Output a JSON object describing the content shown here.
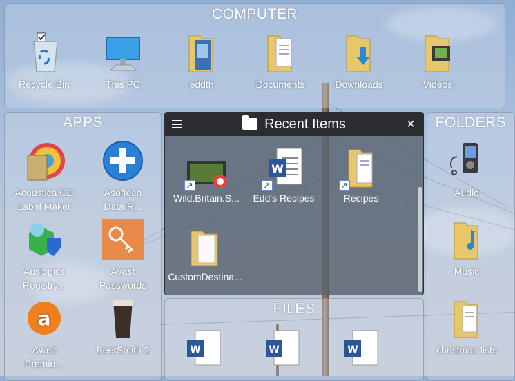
{
  "computer": {
    "title": "COMPUTER",
    "items": [
      {
        "label": "Recycle Bin",
        "icon": "recycle-bin-icon"
      },
      {
        "label": "This PC",
        "icon": "monitor-icon"
      },
      {
        "label": "eddth",
        "icon": "user-folder-icon"
      },
      {
        "label": "Documents",
        "icon": "documents-folder-icon"
      },
      {
        "label": "Downloads",
        "icon": "downloads-folder-icon"
      },
      {
        "label": "Videos",
        "icon": "videos-folder-icon"
      }
    ]
  },
  "apps": {
    "title": "APPS",
    "items": [
      {
        "label1": "Acoustica CD",
        "label2": "Label Maker"
      },
      {
        "label1": "Asoftech",
        "label2": "Data R..."
      },
      {
        "label1": "Auslogics",
        "label2": "Registry..."
      },
      {
        "label1": "Avast",
        "label2": "Passwords"
      },
      {
        "label1": "Avast",
        "label2": "Premiu..."
      },
      {
        "label1": "BeerSmith 2",
        "label2": ""
      }
    ]
  },
  "recent": {
    "title": "Recent Items",
    "items": [
      {
        "label": "Wild.Britain.S..."
      },
      {
        "label": "Edd's Recipes"
      },
      {
        "label": "Recipes"
      },
      {
        "label": "CustomDestina..."
      }
    ]
  },
  "folders": {
    "title": "FOLDERS",
    "items": [
      {
        "label": "Audio"
      },
      {
        "label": "Music"
      },
      {
        "label": "christmas lists"
      }
    ]
  },
  "files": {
    "title": "FILES"
  },
  "colors": {
    "word_blue": "#2b579a",
    "folder_yellow": "#e8c66a",
    "avast_orange": "#f07f1d",
    "titlebar": "#2b2d31"
  }
}
